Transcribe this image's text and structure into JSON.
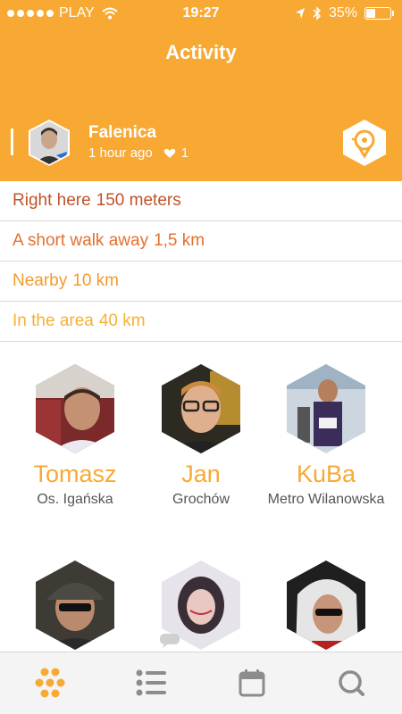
{
  "status_bar": {
    "carrier": "PLAY",
    "time": "19:27",
    "battery_percent": "35%",
    "battery_level": 0.35,
    "icons": [
      "signal-dots-icon",
      "wifi-icon",
      "location-arrow-icon",
      "bluetooth-icon",
      "battery-icon"
    ]
  },
  "header": {
    "title": "Activity",
    "checkin": {
      "place": "Falenica",
      "time_ago": "1 hour ago",
      "likes": "1",
      "icons": [
        "avatar",
        "heart-icon",
        "locate-pin-icon"
      ]
    }
  },
  "distances": [
    {
      "label": "Right here",
      "value": "150 meters",
      "color": "#c0532a"
    },
    {
      "label": "A short walk away",
      "value": "1,5 km",
      "color": "#e4702f"
    },
    {
      "label": "Nearby",
      "value": "10 km",
      "color": "#f39a2e"
    },
    {
      "label": "In the area",
      "value": "40 km",
      "color": "#f8b033"
    }
  ],
  "people": [
    {
      "name": "Tomasz",
      "location": "Os. Igańska"
    },
    {
      "name": "Jan",
      "location": "Grochów"
    },
    {
      "name": "KuBa",
      "location": "Metro Wilanowska"
    },
    {
      "name": "",
      "location": ""
    },
    {
      "name": "",
      "location": ""
    },
    {
      "name": "",
      "location": ""
    }
  ],
  "tabbar": {
    "tabs": [
      "honeycomb-icon",
      "list-icon",
      "calendar-icon",
      "search-icon"
    ],
    "active_tab": "honeycomb-icon",
    "active_color": "#f8a933",
    "inactive_color": "#8c8c8c"
  },
  "colors": {
    "accent": "#f8a933",
    "header_bg": "#f8a933",
    "divider": "#d9d9d9",
    "name_color": "#f8a933"
  }
}
